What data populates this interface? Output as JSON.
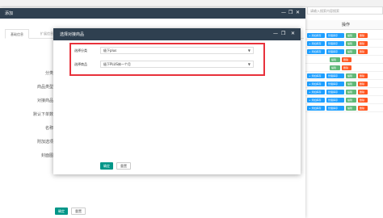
{
  "background": {
    "search_placeholder": "请输入搜索内容搜索",
    "table_header": "操作",
    "rows": [
      {
        "buttons": [
          "+ 添加库存",
          "管理库存",
          "编辑",
          "删除"
        ]
      },
      {
        "buttons": [
          "+ 添加库存",
          "管理库存",
          "编辑",
          "删除"
        ]
      },
      {
        "buttons": [
          "+ 添加库存",
          "管理库存",
          "编辑",
          "删除"
        ]
      },
      {
        "buttons": [
          "编辑",
          "删除"
        ]
      },
      {
        "buttons": [
          "编辑",
          "删除"
        ]
      },
      {
        "buttons": [
          "+ 添加库存",
          "管理库存",
          "编辑",
          "删除"
        ]
      },
      {
        "buttons": [
          "+ 添加库存",
          "管理库存",
          "编辑",
          "删除"
        ]
      },
      {
        "buttons": [
          "+ 添加库存",
          "管理库存",
          "编辑",
          "删除"
        ]
      },
      {
        "buttons": [
          "+ 添加库存",
          "管理库存",
          "编辑",
          "删除"
        ]
      },
      {
        "buttons": [
          "+ 添加库存",
          "管理库存",
          "编辑",
          "删除"
        ]
      }
    ]
  },
  "outer_dialog": {
    "title": "添加",
    "tabs": [
      "基础信息",
      "扩展信息"
    ],
    "fields": [
      "分类",
      "商品类型",
      "对接商品",
      "默认下单数",
      "名称",
      "附加选项",
      "封面图"
    ],
    "confirm_label": "确定",
    "reset_label": "重置"
  },
  "inner_dialog": {
    "title": "选择对接商品",
    "category_label": "选择分类",
    "category_value": "极下plus",
    "product_label": "选择商品",
    "product_value": "极下PLUS体一个月",
    "confirm_label": "确定",
    "reset_label": "重置"
  },
  "colors": {
    "titlebar": "#2f4050",
    "primary": "#009688",
    "highlight": "#e8313b",
    "btn_blue": "#1e9fff",
    "btn_green": "#5fb878",
    "btn_red": "#ff5722"
  },
  "icons": {
    "minimize": "minimize-icon",
    "maximize": "maximize-icon",
    "close": "close-icon",
    "dropdown": "chevron-down-icon"
  }
}
